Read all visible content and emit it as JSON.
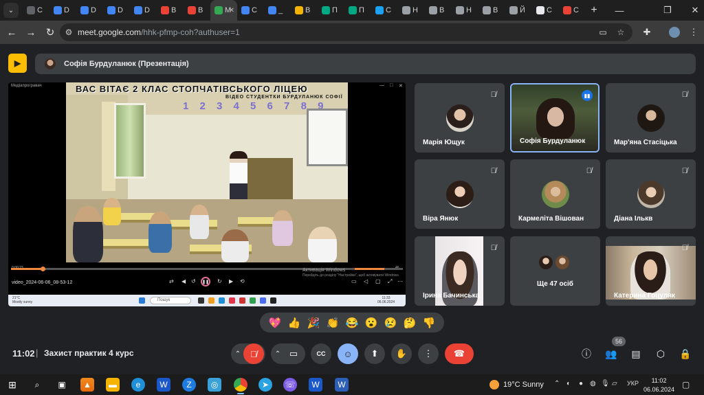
{
  "browser": {
    "tabs": [
      {
        "label": "C",
        "color": "#5f6368"
      },
      {
        "label": "D",
        "color": "#4285f4"
      },
      {
        "label": "D",
        "color": "#4285f4"
      },
      {
        "label": "D",
        "color": "#4285f4"
      },
      {
        "label": "D",
        "color": "#4285f4"
      },
      {
        "label": "B",
        "color": "#ea4335"
      },
      {
        "label": "B",
        "color": "#ea4335"
      },
      {
        "label": "M",
        "color": "#34a853"
      },
      {
        "label": "C",
        "color": "#4285f4"
      },
      {
        "label": "_",
        "color": "#4285f4"
      },
      {
        "label": "B",
        "color": "#f4b400"
      },
      {
        "label": "П",
        "color": "#00a884"
      },
      {
        "label": "П",
        "color": "#00a884"
      },
      {
        "label": "C",
        "color": "#1da1f2"
      },
      {
        "label": "Н",
        "color": "#9aa0a6"
      },
      {
        "label": "В",
        "color": "#9aa0a6"
      },
      {
        "label": "Н",
        "color": "#9aa0a6"
      },
      {
        "label": "В",
        "color": "#9aa0a6"
      },
      {
        "label": "Й",
        "color": "#9aa0a6"
      },
      {
        "label": "С",
        "color": "#e8eaed"
      },
      {
        "label": "С",
        "color": "#ea4335"
      }
    ],
    "new_tab": "+",
    "url_host": "meet.google.com",
    "url_path": "/hhk-pfmp-coh?authuser=1"
  },
  "meet": {
    "presenter_bar": "Софія Бурдуланюк (Презентація)",
    "meeting_time": "11:02",
    "separator": "|",
    "meeting_name": "Захист практик 4 курс",
    "participants_count": "56",
    "reactions": [
      "💖",
      "👍",
      "🎉",
      "👏",
      "😂",
      "😮",
      "😢",
      "🤔",
      "👎"
    ]
  },
  "presentation": {
    "player_title": "Медіапрогравач",
    "video_title_line1": "ВАС ВІТАЄ 2 КЛАС СТОПЧАТІВСЬКОГО ЛІЦЕЮ",
    "video_title_line2": "ВІДЕО СТУДЕНТКИ БУРДУЛАНЮК СОФІЇ",
    "numbers_on_wall": "1 2 3 4 5 6 7 8 9",
    "elapsed": "0:00:23",
    "remaining": "46",
    "file_name": "video_2024-06-06_08-53-12",
    "watermark_title": "Активація Windows",
    "watermark_sub": "Перейдіть до розділу \"Настройки\", щоб активувати Windows.",
    "progress_fraction": 0.08,
    "volume_fraction": 0.62,
    "inner_taskbar": {
      "weather_temp": "21°C",
      "weather_desc": "Mostly sunny",
      "search": "Пошук",
      "time": "11:33",
      "date": "06.06.2024"
    }
  },
  "tiles": [
    {
      "name": "Марія Ющук",
      "muted": true,
      "avatar_color": "#5a4636"
    },
    {
      "name": "Софія Бурдуланюк",
      "muted": false,
      "speaking": true
    },
    {
      "name": "Мар'яна Стасіцька",
      "muted": true,
      "avatar_color": "#2b2018"
    },
    {
      "name": "Віра Янюк",
      "muted": true,
      "avatar_color": "#3a2a22"
    },
    {
      "name": "Кармеліта Вішован",
      "muted": true,
      "avatar_color": "#6f8b4a"
    },
    {
      "name": "Діана Ількв",
      "muted": true,
      "avatar_color": "#5b4b3b"
    },
    {
      "name": "Ірина Бачинська",
      "muted": true
    },
    {
      "name": "Ще 47 осіб",
      "muted": false
    },
    {
      "name": "Катерина Гоцуляк",
      "muted": true
    }
  ],
  "taskbar": {
    "weather": "19°C  Sunny",
    "lang": "УКР",
    "time": "11:02",
    "date": "06.06.2024"
  },
  "colors": {
    "end_call": "#ea4335",
    "mic_off": "#ea4335",
    "reactions_on": "#8ab4f8",
    "present": "#fbbc04",
    "speaking_border": "#8ab4f8"
  }
}
